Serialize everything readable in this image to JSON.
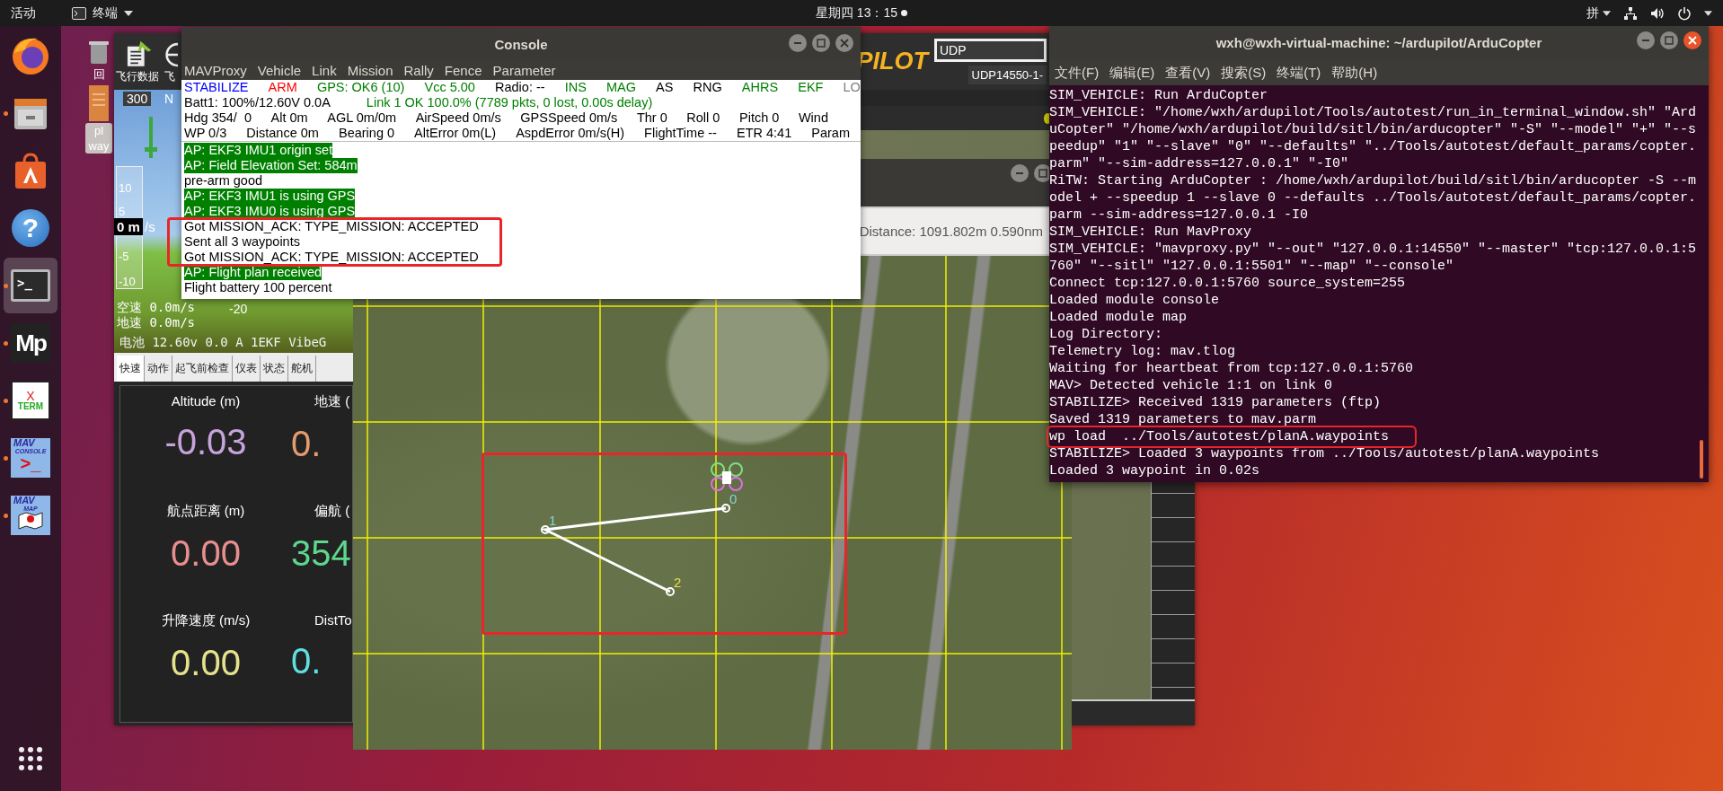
{
  "top_bar": {
    "activities": "活动",
    "app_menu": "终端",
    "clock": "星期四 13：15",
    "input_method": "拼"
  },
  "dock": {
    "items": [
      {
        "kind": "firefox",
        "running": false,
        "selected": false
      },
      {
        "kind": "files",
        "running": true,
        "selected": false
      },
      {
        "kind": "software",
        "running": false,
        "selected": false
      },
      {
        "kind": "help",
        "glyph": "?",
        "running": false,
        "selected": false
      },
      {
        "kind": "terminal",
        "glyph": ">_",
        "running": true,
        "selected": true
      },
      {
        "kind": "mp",
        "glyph": "Mp",
        "running": true,
        "selected": false
      },
      {
        "kind": "xterm",
        "texts": [
          "X",
          "TERM"
        ],
        "running": true,
        "selected": false
      },
      {
        "kind": "mavconsole",
        "texts": [
          "MAV",
          "CONSOLE",
          ">_"
        ],
        "running": true,
        "selected": false
      },
      {
        "kind": "mavmap",
        "texts": [
          "MAV",
          "MAP"
        ],
        "running": true,
        "selected": false
      }
    ]
  },
  "desktop_icons": [
    {
      "kind": "trash",
      "label": "回",
      "selected": false
    },
    {
      "kind": "file",
      "label": "pl way",
      "selected": true
    }
  ],
  "mission_planner": {
    "toolbar": [
      {
        "label": "飞行数据"
      },
      {
        "label": "飞"
      }
    ],
    "logo": "PILOT",
    "connection_type": "UDP",
    "connection_port": "UDP14550-1-",
    "hud": {
      "heading": "300",
      "heading_mark": "N",
      "alt_scale": [
        "10",
        "5",
        "-5",
        "-10"
      ],
      "vspeed": "0 m",
      "vspeed_unit": "/s",
      "airspeed": "空速 0.0m/s",
      "groundspeed": "地速 0.0m/s",
      "pitch_mark": "-20",
      "status": "电池 12.60v 0.0 A 1EKF VibeG"
    },
    "tabs": [
      {
        "label": "快速",
        "selected": true
      },
      {
        "label": "动作",
        "selected": false
      },
      {
        "label": "起飞前检查",
        "selected": false
      },
      {
        "label": "仪表",
        "selected": false
      },
      {
        "label": "状态",
        "selected": false
      },
      {
        "label": "舵机",
        "selected": false
      }
    ],
    "quick": [
      {
        "label": "Altitude (m)",
        "value": "-0.03",
        "color": "#c7a3dc"
      },
      {
        "label": "地速 (",
        "value": "0.",
        "color": "#e59b6e"
      },
      {
        "label": "航点距离 (m)",
        "value": "0.00",
        "color": "#e88e8e"
      },
      {
        "label": "偏航 (",
        "value": "354",
        "color": "#5ed68c"
      },
      {
        "label": "升降速度 (m/s)",
        "value": "0.00",
        "color": "#e6e28c"
      },
      {
        "label": "DistTo",
        "value": "0.",
        "color": "#5fe0e0"
      }
    ]
  },
  "map_window": {
    "distance": "Distance: 1091.802m 0.590nm",
    "waypoints": [
      {
        "label": "0",
        "color": "#7fd8d8"
      },
      {
        "label": "1",
        "color": "#7fd8d8"
      },
      {
        "label": "2",
        "color": "#e8e040"
      }
    ]
  },
  "console": {
    "title": "Console",
    "menu": [
      "MAVProxy",
      "Vehicle",
      "Link",
      "Mission",
      "Rally",
      "Fence",
      "Parameter"
    ],
    "status_rows": [
      [
        {
          "text": "STABILIZE",
          "color": "#0000ff"
        },
        {
          "text": "ARM",
          "color": "#ff0000"
        },
        {
          "text": "GPS: OK6 (10)",
          "color": "#008000"
        },
        {
          "text": "Vcc 5.00",
          "color": "#008000"
        },
        {
          "text": "Radio: --",
          "color": "#000000"
        },
        {
          "text": "INS",
          "color": "#008000"
        },
        {
          "text": "MAG",
          "color": "#008000"
        },
        {
          "text": "AS",
          "color": "#000000"
        },
        {
          "text": "RNG",
          "color": "#000000"
        },
        {
          "text": "AHRS",
          "color": "#008000"
        },
        {
          "text": "EKF",
          "color": "#008000"
        },
        {
          "text": "LO",
          "color": "#808080"
        }
      ],
      [
        {
          "text": "Batt1: 100%/12.60V 0.0A",
          "color": "#000000"
        },
        {
          "text": "Link 1 OK 100.0% (7789 pkts, 0 lost, 0.00s delay)",
          "color": "#008000"
        }
      ],
      [
        {
          "text": "Hdg 354/  0",
          "color": "#000000"
        },
        {
          "text": "Alt 0m",
          "color": "#000000"
        },
        {
          "text": "AGL 0m/0m",
          "color": "#000000"
        },
        {
          "text": "AirSpeed 0m/s",
          "color": "#000000"
        },
        {
          "text": "GPSSpeed 0m/s",
          "color": "#000000"
        },
        {
          "text": "Thr 0",
          "color": "#000000"
        },
        {
          "text": "Roll 0",
          "color": "#000000"
        },
        {
          "text": "Pitch 0",
          "color": "#000000"
        },
        {
          "text": "Wind",
          "color": "#000000"
        }
      ],
      [
        {
          "text": "WP 0/3",
          "color": "#000000"
        },
        {
          "text": "Distance 0m",
          "color": "#000000"
        },
        {
          "text": "Bearing 0",
          "color": "#000000"
        },
        {
          "text": "AltError 0m(L)",
          "color": "#000000"
        },
        {
          "text": "AspdError 0m/s(H)",
          "color": "#000000"
        },
        {
          "text": "FlightTime --",
          "color": "#000000"
        },
        {
          "text": "ETR 4:41",
          "color": "#000000"
        },
        {
          "text": "Param",
          "color": "#000000"
        }
      ]
    ],
    "log": [
      {
        "text": "AP: EKF3 IMU1 origin set",
        "highlight": true
      },
      {
        "text": "AP: Field Elevation Set: 584m",
        "highlight": true
      },
      {
        "text": "pre-arm good",
        "highlight": false
      },
      {
        "text": "AP: EKF3 IMU1 is using GPS",
        "highlight": true
      },
      {
        "text": "AP: EKF3 IMU0 is using GPS",
        "highlight": true
      },
      {
        "text": "Got MISSION_ACK: TYPE_MISSION: ACCEPTED",
        "highlight": false
      },
      {
        "text": "Sent all 3 waypoints",
        "highlight": false
      },
      {
        "text": "Got MISSION_ACK: TYPE_MISSION: ACCEPTED",
        "highlight": false
      },
      {
        "text": "AP: Flight plan received",
        "highlight": true
      },
      {
        "text": "Flight battery 100 percent",
        "highlight": false
      }
    ]
  },
  "terminal": {
    "title": "wxh@wxh-virtual-machine: ~/ardupilot/ArduCopter",
    "menu": [
      "文件(F)",
      "编辑(E)",
      "查看(V)",
      "搜索(S)",
      "终端(T)",
      "帮助(H)"
    ],
    "lines": [
      {
        "text": "SIM_VEHICLE: Run ArduCopter",
        "marked": false
      },
      {
        "text": "SIM_VEHICLE: \"/home/wxh/ardupilot/Tools/autotest/run_in_terminal_window.sh\" \"Ard",
        "marked": false
      },
      {
        "text": "uCopter\" \"/home/wxh/ardupilot/build/sitl/bin/arducopter\" \"-S\" \"--model\" \"+\" \"--s",
        "marked": false
      },
      {
        "text": "peedup\" \"1\" \"--slave\" \"0\" \"--defaults\" \"../Tools/autotest/default_params/copter.",
        "marked": false
      },
      {
        "text": "parm\" \"--sim-address=127.0.0.1\" \"-I0\"",
        "marked": false
      },
      {
        "text": "RiTW: Starting ArduCopter : /home/wxh/ardupilot/build/sitl/bin/arducopter -S --m",
        "marked": false
      },
      {
        "text": "odel + --speedup 1 --slave 0 --defaults ../Tools/autotest/default_params/copter.",
        "marked": false
      },
      {
        "text": "parm --sim-address=127.0.0.1 -I0",
        "marked": false
      },
      {
        "text": "SIM_VEHICLE: Run MavProxy",
        "marked": false
      },
      {
        "text": "SIM_VEHICLE: \"mavproxy.py\" \"--out\" \"127.0.0.1:14550\" \"--master\" \"tcp:127.0.0.1:5",
        "marked": false
      },
      {
        "text": "760\" \"--sitl\" \"127.0.0.1:5501\" \"--map\" \"--console\"",
        "marked": false
      },
      {
        "text": "Connect tcp:127.0.0.1:5760 source_system=255",
        "marked": false
      },
      {
        "text": "Loaded module console",
        "marked": false
      },
      {
        "text": "Loaded module map",
        "marked": false
      },
      {
        "text": "Log Directory:",
        "marked": false
      },
      {
        "text": "Telemetry log: mav.tlog",
        "marked": false
      },
      {
        "text": "Waiting for heartbeat from tcp:127.0.0.1:5760",
        "marked": false
      },
      {
        "text": "MAV> Detected vehicle 1:1 on link 0",
        "marked": false
      },
      {
        "text": "STABILIZE> Received 1319 parameters (ftp)",
        "marked": false
      },
      {
        "text": "Saved 1319 parameters to mav.parm",
        "marked": false
      },
      {
        "text": "wp load  ../Tools/autotest/planA.waypoints",
        "marked": true
      },
      {
        "text": "STABILIZE> Loaded 3 waypoints from ../Tools/autotest/planA.waypoints",
        "marked": false
      },
      {
        "text": "Loaded 3 waypoint in 0.02s",
        "marked": false
      }
    ]
  }
}
